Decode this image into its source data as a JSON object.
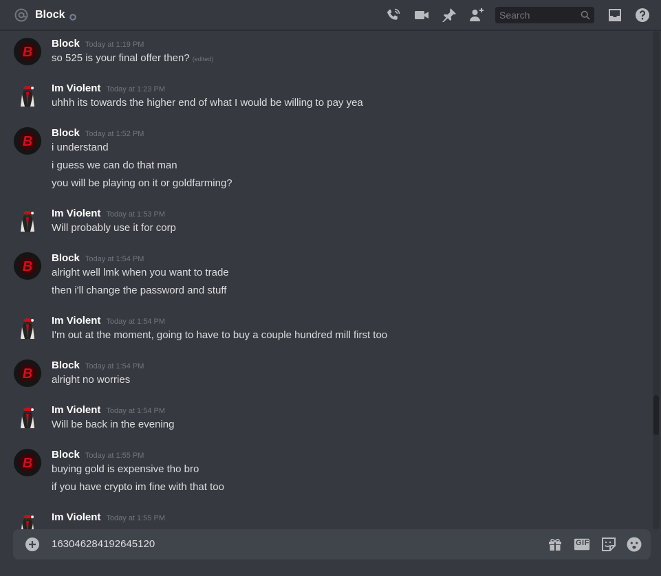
{
  "header": {
    "channel_name": "Block",
    "search_placeholder": "Search",
    "icons": [
      "at-icon",
      "status-icon",
      "call-icon",
      "video-icon",
      "pin-icon",
      "add-friend-icon",
      "search-icon",
      "inbox-icon",
      "help-icon"
    ]
  },
  "messages": [
    {
      "author": "Block",
      "timestamp": "Today at 1:19 PM",
      "lines": [
        "so 525 is your final offer then?"
      ],
      "edited_label": "(edited)"
    },
    {
      "author": "Im Violent",
      "timestamp": "Today at 1:23 PM",
      "lines": [
        "uhhh its towards the higher end of what I would be willing to pay yea"
      ]
    },
    {
      "author": "Block",
      "timestamp": "Today at 1:52 PM",
      "lines": [
        "i understand",
        "i guess we can do that man",
        "you will be playing on it or goldfarming?"
      ]
    },
    {
      "author": "Im Violent",
      "timestamp": "Today at 1:53 PM",
      "lines": [
        "Will probably use it for corp"
      ]
    },
    {
      "author": "Block",
      "timestamp": "Today at 1:54 PM",
      "lines": [
        "alright well lmk when you want to trade",
        "then i'll change the password and stuff"
      ]
    },
    {
      "author": "Im Violent",
      "timestamp": "Today at 1:54 PM",
      "lines": [
        "I'm out at the moment, going to have to buy a couple hundred mill first too"
      ]
    },
    {
      "author": "Block",
      "timestamp": "Today at 1:54 PM",
      "lines": [
        "alright no worries"
      ]
    },
    {
      "author": "Im Violent",
      "timestamp": "Today at 1:54 PM",
      "lines": [
        "Will be back in the evening"
      ]
    },
    {
      "author": "Block",
      "timestamp": "Today at 1:55 PM",
      "lines": [
        "buying gold is expensive tho bro",
        "if you have crypto im fine with that too"
      ]
    },
    {
      "author": "Im Violent",
      "timestamp": "Today at 1:55 PM",
      "lines": []
    }
  ],
  "composer": {
    "text": "163046284192645120",
    "gif_label": "GIF",
    "icons": [
      "add-attachment-icon",
      "gift-icon",
      "gif-icon",
      "sticker-icon",
      "emoji-icon"
    ]
  },
  "colors": {
    "background": "#36393f",
    "composer": "#40444b",
    "author": "#ffffff",
    "text": "#dcddde",
    "muted": "#72767d",
    "avatar_red": "#d2101b"
  }
}
